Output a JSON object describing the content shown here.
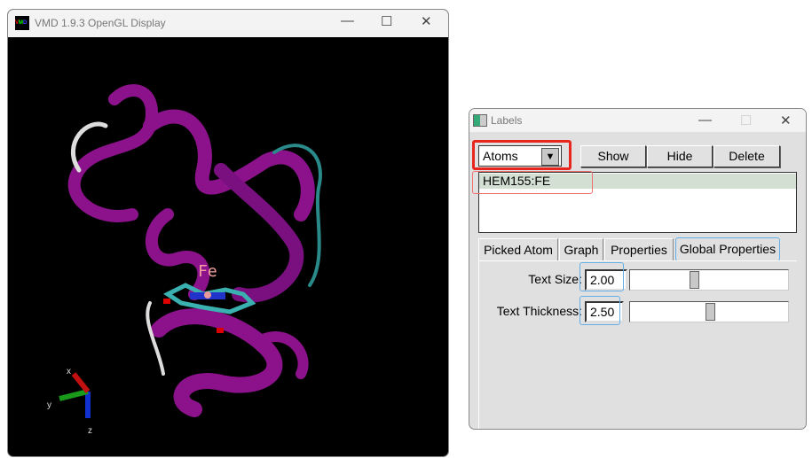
{
  "vmd_window": {
    "title": "VMD 1.9.3 OpenGL Display",
    "icon": "vmd-logo-icon",
    "atom_label": "Fe",
    "axes": {
      "x": "x",
      "y": "y",
      "z": "z"
    }
  },
  "labels_window": {
    "title": "Labels",
    "category_select": "Atoms",
    "buttons": {
      "show": "Show",
      "hide": "Hide",
      "delete": "Delete"
    },
    "list_items": [
      "HEM155:FE"
    ],
    "tabs": [
      "Picked Atom",
      "Graph",
      "Properties",
      "Global Properties"
    ],
    "active_tab": "Global Properties",
    "text_size": {
      "label": "Text Size:",
      "value": "2.00"
    },
    "text_thickness": {
      "label": "Text Thickness:",
      "value": "2.50"
    },
    "highlight_colors": {
      "red": "#e8261e",
      "blue": "#62aee8",
      "selection": "#d3dfd3"
    }
  }
}
